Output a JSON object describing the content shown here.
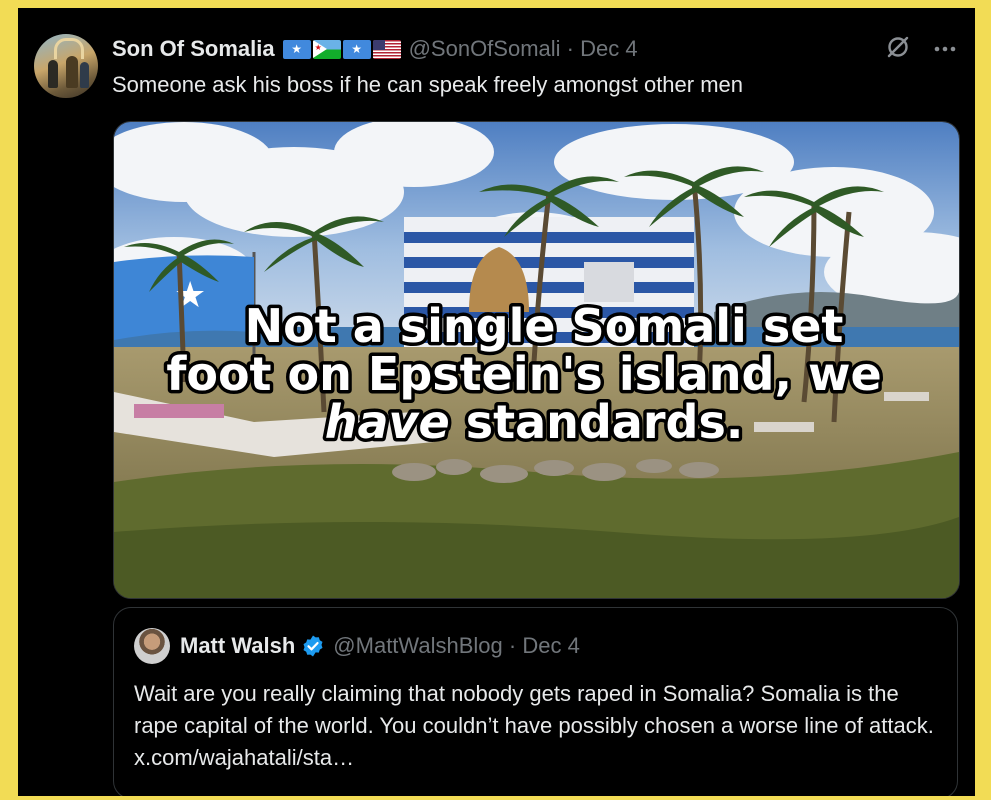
{
  "tweet": {
    "author_name": "Son Of Somalia",
    "handle": "@SonOfSomali",
    "date": "Dec 4",
    "flag_icons": [
      "somalia-flag-icon",
      "djibouti-flag-icon",
      "somalia-flag-icon",
      "usa-flag-icon"
    ],
    "text": "Someone ask his boss if he can speak freely amongst other men",
    "actions": [
      "grok-icon",
      "more-icon"
    ]
  },
  "media": {
    "caption_line1": "Not a single Somali set",
    "caption_line2": "foot on Epstein's island, we",
    "caption_line3_italic": "have",
    "caption_line3_rest": " standards."
  },
  "quote": {
    "author_name": "Matt Walsh",
    "verified": true,
    "handle": "@MattWalshBlog",
    "date": "Dec 4",
    "text": "Wait are you really claiming that nobody gets raped in Somalia? Somalia is the rape capital of the world. You couldn’t have possibly chosen a worse line of attack.",
    "link_text": "x.com/wajahatali/sta…"
  },
  "colors": {
    "page_border": "#f2dc55",
    "background": "#000000",
    "text_primary": "#e7e9ea",
    "text_secondary": "#71767b",
    "verified_blue": "#1d9bf0",
    "card_border": "#2f3336"
  }
}
